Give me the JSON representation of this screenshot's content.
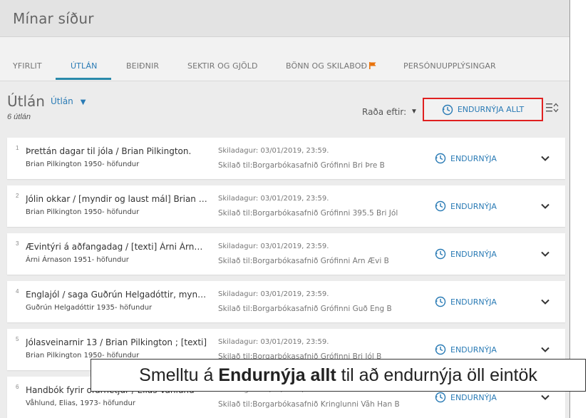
{
  "page_title": "Mínar síður",
  "tabs": [
    {
      "label": "YFIRLIT",
      "active": false
    },
    {
      "label": "ÚTLÁN",
      "active": true
    },
    {
      "label": "BEIÐNIR",
      "active": false
    },
    {
      "label": "SEKTIR OG GJÖLD",
      "active": false
    },
    {
      "label": "BÖNN OG SKILABOÐ",
      "active": false,
      "icon": "flag-icon"
    },
    {
      "label": "PERSÓNUUPPLÝSINGAR",
      "active": false
    }
  ],
  "loans": {
    "title": "Útlán",
    "filter_label": "Útlán",
    "count_text": "6 útlán",
    "sort_label": "Raða eftir:",
    "renew_all_label": "ENDURNÝJA ALLT",
    "renew_label": "ENDURNÝJA",
    "items": [
      {
        "num": "1",
        "title": "Þrettán dagar til jóla / Brian Pilkington.",
        "author": "Brian Pilkington 1950- höfundur",
        "due": "Skiladagur: 03/01/2019, 23:59.",
        "return_to": "Skilað til:Borgarbókasafnið Grófinni Bri Þre B"
      },
      {
        "num": "2",
        "title": "Jólin okkar / [myndir og laust mál] Brian Pilkington",
        "author": "Brian Pilkington 1950- höfundur",
        "due": "Skiladagur: 03/01/2019, 23:59.",
        "return_to": "Skilað til:Borgarbókasafnið Grófinni 395.5 Bri Jól"
      },
      {
        "num": "3",
        "title": "Ævintýri á aðfangadag / [texti] Árni Árnason",
        "author": "Árni Árnason 1951- höfundur",
        "due": "Skiladagur: 03/01/2019, 23:59.",
        "return_to": "Skilað til:Borgarbókasafnið Grófinni Árn Ævi B"
      },
      {
        "num": "4",
        "title": "Englajól / saga Guðrún Helgadóttir, myndir",
        "author": "Guðrún Helgadóttir 1935- höfundur",
        "due": "Skiladagur: 03/01/2019, 23:59.",
        "return_to": "Skilað til:Borgarbókasafnið Grófinni Guð Eng B"
      },
      {
        "num": "5",
        "title": "Jólasveinarnir 13 / Brian Pilkington ; [texti]",
        "author": "Brian Pilkington 1950- höfundur",
        "due": "Skiladagur: 03/01/2019, 23:59.",
        "return_to": "Skilað til:Borgarbókasafnið Grófinni Bri Jól B"
      },
      {
        "num": "6",
        "title": "Handbók fyrir ofurhetjur / Elias Våhlund",
        "author": "Våhlund, Elias, 1973- höfundur",
        "due": "Skiladagur: 03/01/2019, 23:59.",
        "return_to": "Skilað til:Borgarbókasafnið Kringlunni Våh Han B"
      }
    ]
  },
  "caption": {
    "before": "Smelltu á",
    "bold": "Endurnýja allt",
    "after": "til að endurnýja öll eintök"
  },
  "colors": {
    "accent": "#2a7bb5",
    "highlight_border": "#e02020",
    "flag": "#e8730c"
  }
}
